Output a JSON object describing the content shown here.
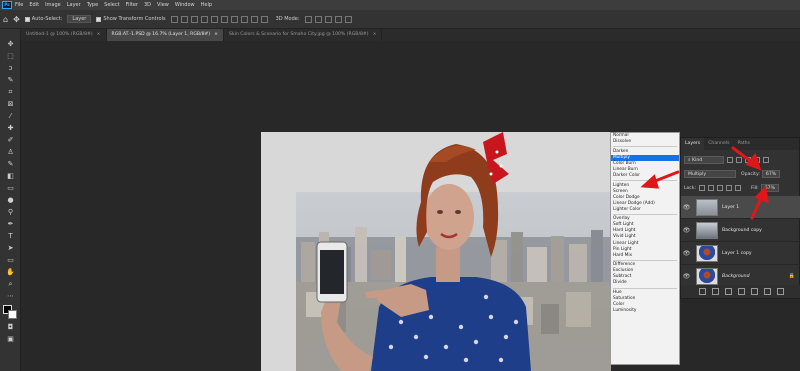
{
  "colors": {
    "accent": "#1473e6",
    "arrow": "#e0161b",
    "panel_bg": "#323232",
    "canvas_bg": "#282828"
  },
  "menu": {
    "items": [
      "File",
      "Edit",
      "Image",
      "Layer",
      "Type",
      "Select",
      "Filter",
      "3D",
      "View",
      "Window",
      "Help"
    ]
  },
  "options": {
    "auto_select_label": "Auto-Select:",
    "auto_select_target": "Layer",
    "show_transform_label": "Show Transform Controls",
    "mode_3d": "3D Mode:"
  },
  "tabs": [
    {
      "label": "Untitled-1 @ 100% (RGB/8#)"
    },
    {
      "label": "RGB.AT.-1.PSD @ 16.7% (Layer 1, RGB/8#)"
    },
    {
      "label": "Skin Colors & Scenario for Smaho City.jpg @ 100% (RGB/8#)"
    }
  ],
  "blend_modes": {
    "groups": [
      [
        "Normal",
        "Dissolve"
      ],
      [
        "Darken",
        "Multiply",
        "Color Burn",
        "Linear Burn",
        "Darker Color"
      ],
      [
        "Lighten",
        "Screen",
        "Color Dodge",
        "Linear Dodge (Add)",
        "Lighter Color"
      ],
      [
        "Overlay",
        "Soft Light",
        "Hard Light",
        "Vivid Light",
        "Linear Light",
        "Pin Light",
        "Hard Mix"
      ],
      [
        "Difference",
        "Exclusion",
        "Subtract",
        "Divide"
      ],
      [
        "Hue",
        "Saturation",
        "Color",
        "Luminosity"
      ]
    ],
    "selected": "Multiply"
  },
  "layers_panel": {
    "tabs": [
      "Layers",
      "Channels",
      "Paths"
    ],
    "kind_filter": "Kind",
    "blend_mode": "Multiply",
    "opacity_label": "Opacity:",
    "opacity_value": "67%",
    "lock_label": "Lock:",
    "fill_label": "Fill:",
    "fill_value": "67%",
    "layers": [
      {
        "name": "Layer 1",
        "active": true,
        "italic": false,
        "locked": false
      },
      {
        "name": "Background copy",
        "active": false,
        "italic": false,
        "locked": false
      },
      {
        "name": "Layer 1 copy",
        "active": false,
        "italic": false,
        "locked": false
      },
      {
        "name": "Background",
        "active": false,
        "italic": true,
        "locked": true
      }
    ]
  },
  "icons": [
    "home-icon",
    "move-tool-icon",
    "eye-icon",
    "lock-icon",
    "link-icon",
    "fx-icon",
    "mask-icon",
    "adjustment-icon",
    "folder-icon",
    "new-layer-icon",
    "trash-icon"
  ]
}
